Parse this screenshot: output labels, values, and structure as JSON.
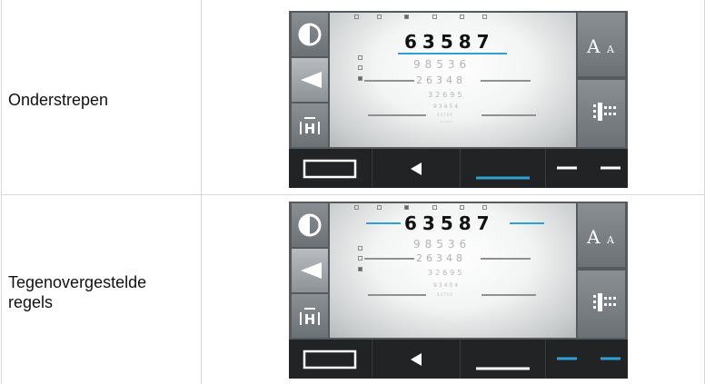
{
  "rows": [
    {
      "label": "Onderstrepen",
      "chart": {
        "top_number": "63587",
        "line2": "98536",
        "line3": "26348",
        "line4": "32695",
        "line5": "93454",
        "line6": "43759",
        "line7": "35454",
        "line8": "",
        "mode": "underline"
      }
    },
    {
      "label": "Tegenovergestelde\nregels",
      "chart": {
        "top_number": "63587",
        "line2": "98536",
        "line3": "26348",
        "line4": "32695",
        "line5": "93454",
        "line6": "43759",
        "line7": "",
        "line8": "",
        "mode": "opposite-lines"
      }
    }
  ],
  "buttons": {
    "contrast": "half-circle-icon",
    "left": "triangle-left-icon",
    "h_icon": "H",
    "font_size": "AA",
    "grid": "grid-icon"
  },
  "colors": {
    "accent": "#2fa0d6",
    "panel": "#555a5e",
    "button": "#7a7f84",
    "bar": "#1a1b1c"
  }
}
